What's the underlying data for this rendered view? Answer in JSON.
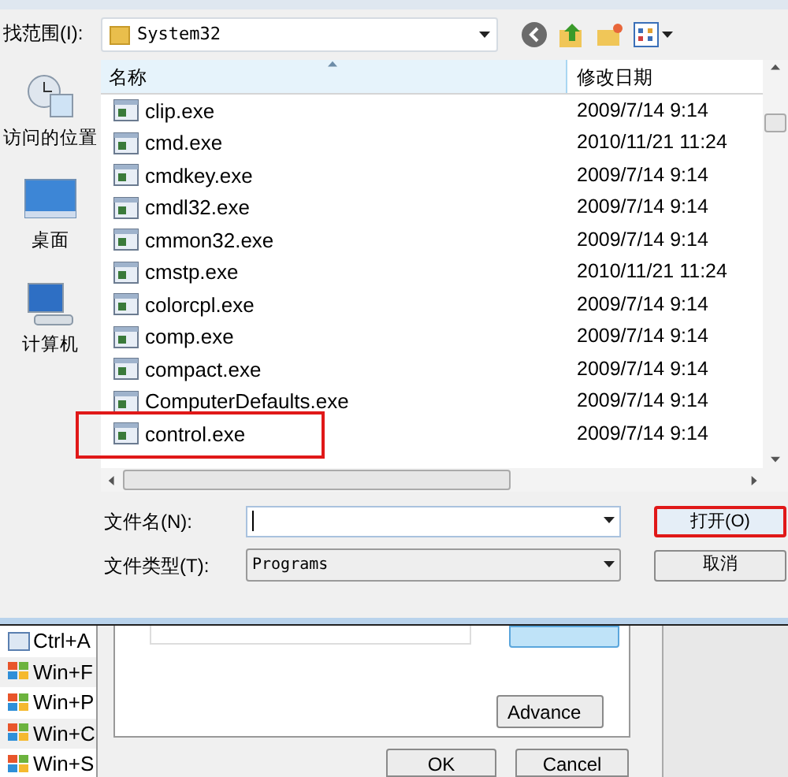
{
  "look_in": {
    "label": "找范围(I):",
    "value": "System32"
  },
  "sidebar": {
    "items": [
      {
        "label": "访问的位置"
      },
      {
        "label": "桌面"
      },
      {
        "label": "计算机"
      }
    ]
  },
  "file_list": {
    "columns": [
      "名称",
      "修改日期"
    ],
    "rows": [
      {
        "name": "clip.exe",
        "date": "2009/7/14 9:14",
        "annotated": false
      },
      {
        "name": "cmd.exe",
        "date": "2010/11/21 11:24",
        "annotated": false
      },
      {
        "name": "cmdkey.exe",
        "date": "2009/7/14 9:14",
        "annotated": false
      },
      {
        "name": "cmdl32.exe",
        "date": "2009/7/14 9:14",
        "annotated": false
      },
      {
        "name": "cmmon32.exe",
        "date": "2009/7/14 9:14",
        "annotated": false
      },
      {
        "name": "cmstp.exe",
        "date": "2010/11/21 11:24",
        "annotated": false
      },
      {
        "name": "colorcpl.exe",
        "date": "2009/7/14 9:14",
        "annotated": false
      },
      {
        "name": "comp.exe",
        "date": "2009/7/14 9:14",
        "annotated": false
      },
      {
        "name": "compact.exe",
        "date": "2009/7/14 9:14",
        "annotated": false
      },
      {
        "name": "ComputerDefaults.exe",
        "date": "2009/7/14 9:14",
        "annotated": false
      },
      {
        "name": "control.exe",
        "date": "2009/7/14 9:14",
        "annotated": true
      }
    ]
  },
  "file_name": {
    "label": "文件名(N):"
  },
  "file_type": {
    "label": "文件类型(T):",
    "value": "Programs"
  },
  "buttons": [
    {
      "label": "打开(O)",
      "annotated": true
    },
    {
      "label": "取消",
      "annotated": false
    }
  ],
  "background_window": {
    "shortcuts": [
      "Ctrl+A",
      "Win+F",
      "Win+P",
      "Win+C",
      "Win+S"
    ],
    "advanced_button": "Advance",
    "ok_button": "OK",
    "cancel_button": "Cancel"
  }
}
